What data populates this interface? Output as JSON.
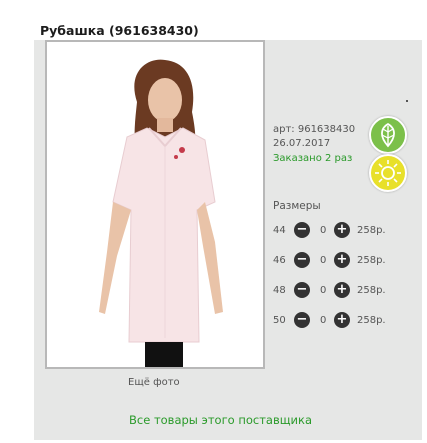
{
  "product": {
    "title": "Рубашка (961638430)",
    "article": "арт: 961638430",
    "date": "26.07.2017",
    "ordered": "Заказано 2 раз",
    "more_photo": "Ещё фото",
    "sizes_label": "Размеры",
    "supplier_link": "Все товары этого поставщика"
  },
  "sizes": [
    {
      "size": "44",
      "qty": "0",
      "price": "258р."
    },
    {
      "size": "46",
      "qty": "0",
      "price": "258р."
    },
    {
      "size": "48",
      "qty": "0",
      "price": "258р."
    },
    {
      "size": "50",
      "qty": "0",
      "price": "258р."
    }
  ],
  "controls": {
    "minus": "−",
    "plus": "+"
  },
  "icons": {
    "eco": "leaf-icon",
    "sun": "sun-icon"
  },
  "colors": {
    "accent_green": "#2a9a2a",
    "eco_green": "#7cc04a",
    "sun_yellow": "#e8e02a",
    "panel_bg": "#e6e7e6"
  }
}
